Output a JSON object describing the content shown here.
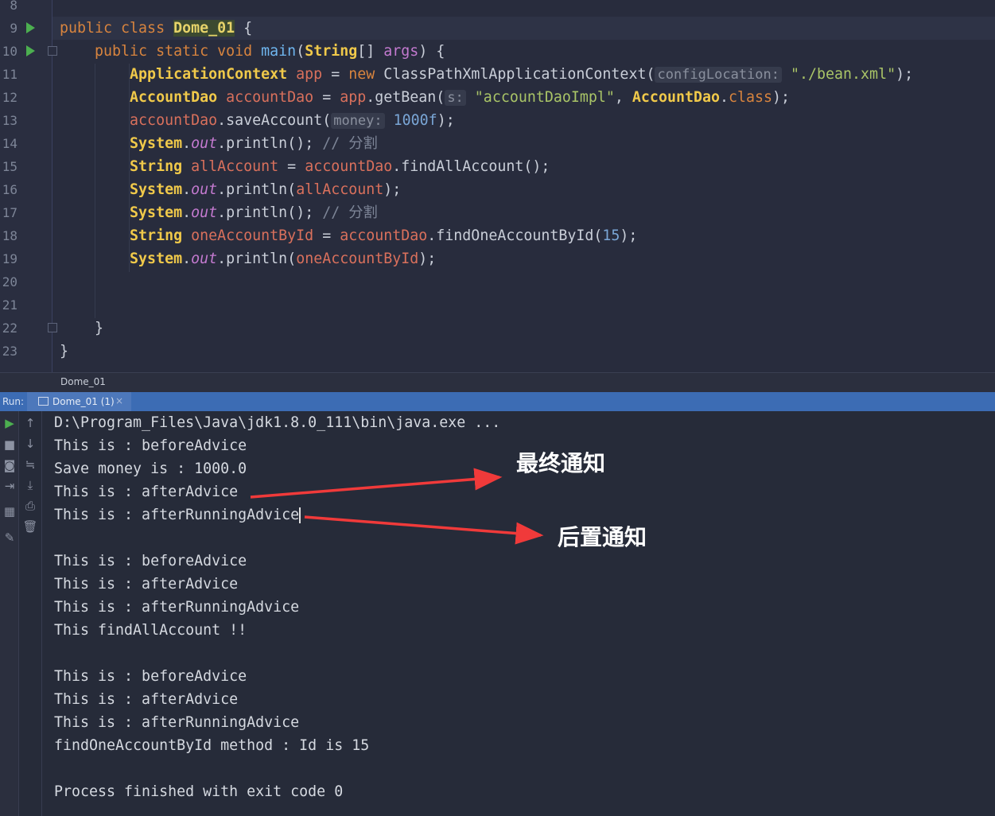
{
  "editor": {
    "line_numbers": [
      "8",
      "9",
      "10",
      "11",
      "12",
      "13",
      "14",
      "15",
      "16",
      "17",
      "18",
      "19",
      "20",
      "21",
      "22",
      "23"
    ],
    "run_gutter_lines": [
      "9",
      "10"
    ],
    "lines": [
      [],
      [
        [
          "kw",
          "public class "
        ],
        [
          "hl",
          "Dome_01"
        ],
        [
          "pl",
          " {"
        ]
      ],
      [
        [
          "kw",
          "    public static void "
        ],
        [
          "fn",
          "main"
        ],
        [
          "pl",
          "("
        ],
        [
          "cls",
          "String"
        ],
        [
          "pl",
          "[] "
        ],
        [
          "par",
          "args"
        ],
        [
          "pl",
          ") {"
        ]
      ],
      [
        [
          "cls",
          "        ApplicationContext "
        ],
        [
          "var",
          "app"
        ],
        [
          "pl",
          " = "
        ],
        [
          "kw",
          "new "
        ],
        [
          "pl",
          "ClassPathXmlApplicationContext("
        ],
        [
          "hint",
          "configLocation:"
        ],
        [
          "str",
          " \"./bean.xml\""
        ],
        [
          "pl",
          ");"
        ]
      ],
      [
        [
          "cls",
          "        AccountDao "
        ],
        [
          "var",
          "accountDao"
        ],
        [
          "pl",
          " = "
        ],
        [
          "var",
          "app"
        ],
        [
          "pl",
          ".getBean("
        ],
        [
          "hint",
          "s:"
        ],
        [
          "str",
          " \"accountDaoImpl\""
        ],
        [
          "pl",
          ", "
        ],
        [
          "cls",
          "AccountDao"
        ],
        [
          "pl",
          "."
        ],
        [
          "kw",
          "class"
        ],
        [
          "pl",
          ");"
        ]
      ],
      [
        [
          "var",
          "        accountDao"
        ],
        [
          "pl",
          ".saveAccount("
        ],
        [
          "hint",
          "money:"
        ],
        [
          "num",
          " 1000f"
        ],
        [
          "pl",
          ");"
        ]
      ],
      [
        [
          "cls",
          "        System"
        ],
        [
          "pl",
          "."
        ],
        [
          "it",
          "out"
        ],
        [
          "pl",
          ".println(); "
        ],
        [
          "cm",
          "// 分割"
        ]
      ],
      [
        [
          "cls",
          "        String "
        ],
        [
          "var",
          "allAccount"
        ],
        [
          "pl",
          " = "
        ],
        [
          "var",
          "accountDao"
        ],
        [
          "pl",
          ".findAllAccount();"
        ]
      ],
      [
        [
          "cls",
          "        System"
        ],
        [
          "pl",
          "."
        ],
        [
          "it",
          "out"
        ],
        [
          "pl",
          ".println("
        ],
        [
          "var",
          "allAccount"
        ],
        [
          "pl",
          ");"
        ]
      ],
      [
        [
          "cls",
          "        System"
        ],
        [
          "pl",
          "."
        ],
        [
          "it",
          "out"
        ],
        [
          "pl",
          ".println(); "
        ],
        [
          "cm",
          "// 分割"
        ]
      ],
      [
        [
          "cls",
          "        String "
        ],
        [
          "var",
          "oneAccountById"
        ],
        [
          "pl",
          " = "
        ],
        [
          "var",
          "accountDao"
        ],
        [
          "pl",
          ".findOneAccountById("
        ],
        [
          "num",
          "15"
        ],
        [
          "pl",
          ");"
        ]
      ],
      [
        [
          "cls",
          "        System"
        ],
        [
          "pl",
          "."
        ],
        [
          "it",
          "out"
        ],
        [
          "pl",
          ".println("
        ],
        [
          "var",
          "oneAccountById"
        ],
        [
          "pl",
          ");"
        ]
      ],
      [],
      [],
      [
        [
          "pl",
          "    }"
        ]
      ],
      [
        [
          "pl",
          "}"
        ]
      ]
    ]
  },
  "breadcrumb": "Dome_01",
  "run_panel": {
    "label": "Run:",
    "tab": "Dome_01 (1)"
  },
  "console": {
    "lines": [
      "D:\\Program_Files\\Java\\jdk1.8.0_111\\bin\\java.exe ...",
      "This is : beforeAdvice",
      "Save money is : 1000.0",
      "This is : afterAdvice",
      "This is : afterRunningAdvice",
      "",
      "This is : beforeAdvice",
      "This is : afterAdvice",
      "This is : afterRunningAdvice",
      "This findAllAccount !!",
      "",
      "This is : beforeAdvice",
      "This is : afterAdvice",
      "This is : afterRunningAdvice",
      "findOneAccountById method : Id is 15",
      "",
      "Process finished with exit code 0"
    ]
  },
  "annotations": {
    "final_advice": "最终通知",
    "after_returning_advice": "后置通知",
    "arrow_color": "#f03a3a"
  }
}
